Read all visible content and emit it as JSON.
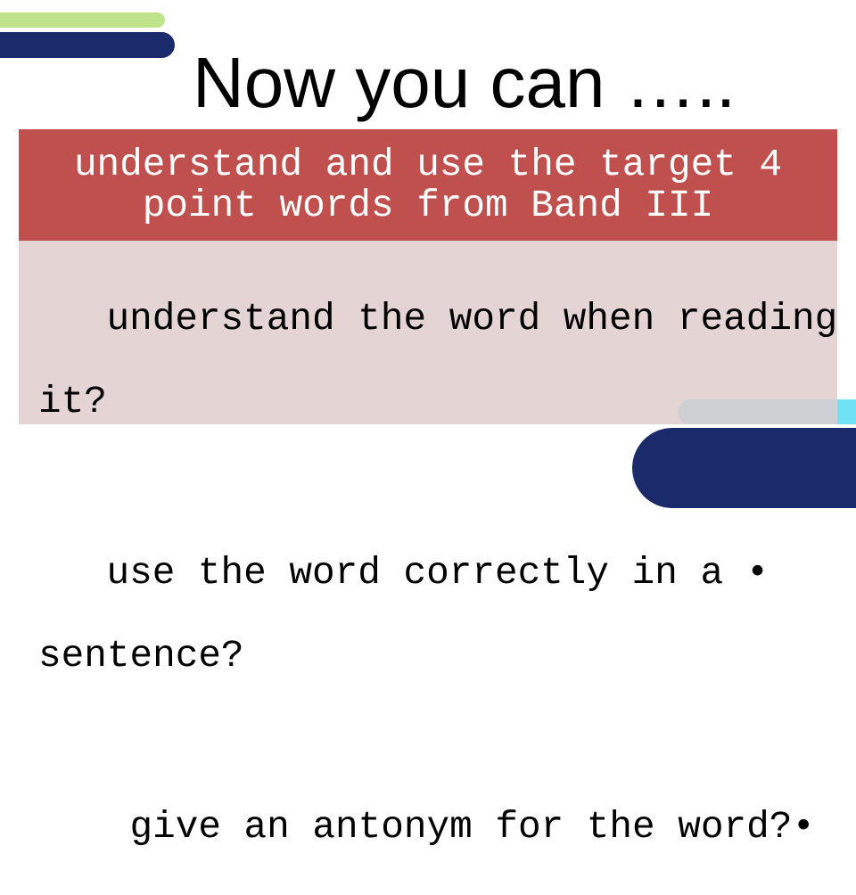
{
  "slide": {
    "title": "Now you can …..",
    "objective": {
      "lines": [
        "understand and use the target 4",
        "point words from Band III"
      ]
    },
    "checklist": [
      {
        "first_line": "understand the word when reading •",
        "continuation": "it?"
      },
      {
        "first_line": "use the word correctly in a •",
        "continuation": "sentence?"
      },
      {
        "first_line": "give an antonym for the word?•",
        "continuation": ""
      }
    ],
    "colors": {
      "accent_green": "#bfe38a",
      "navy": "#1b2a6b",
      "header_red": "#c0504d",
      "body_pink": "#e0cccd",
      "accent_cyan": "#6fe3f5"
    }
  }
}
